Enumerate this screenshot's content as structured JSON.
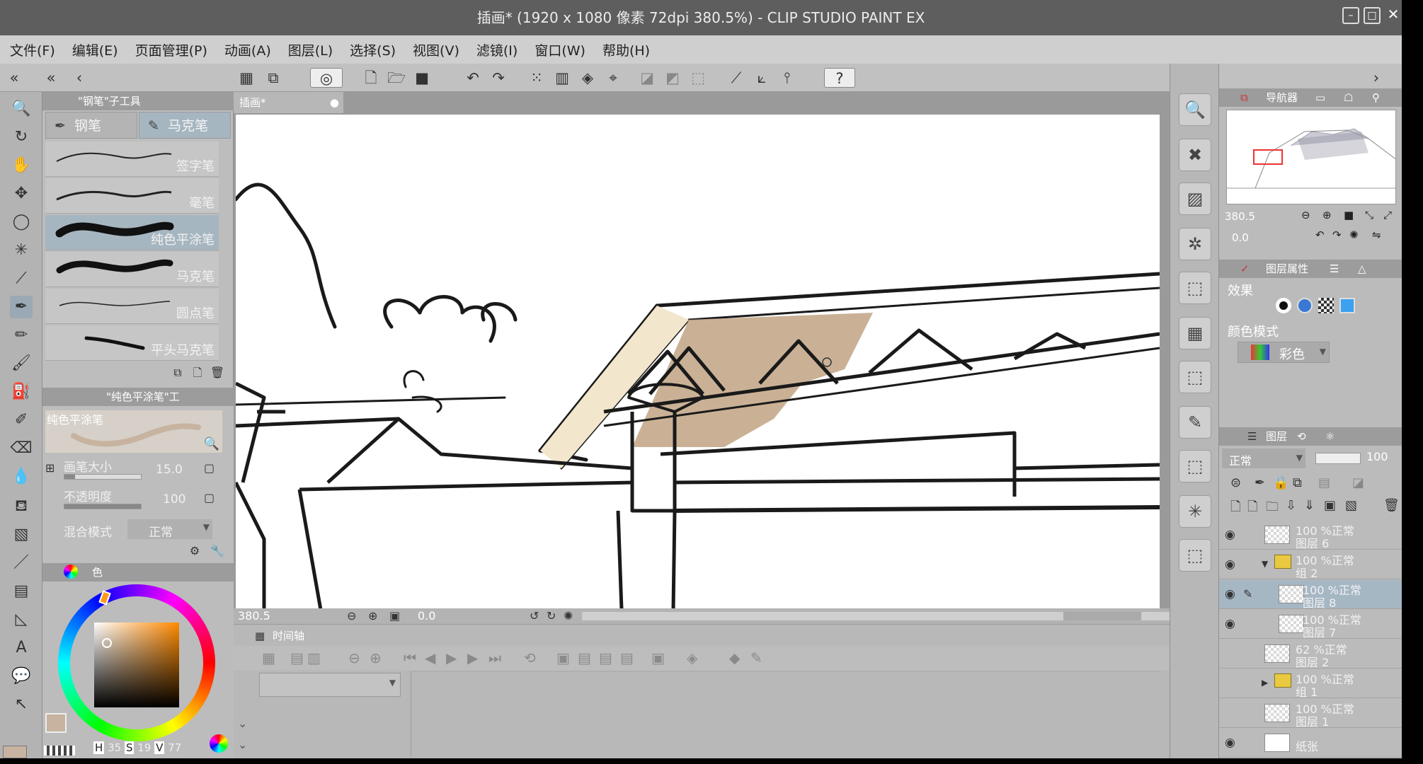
{
  "title": "插画* (1920 x 1080 像素 72dpi 380.5%) - CLIP STUDIO PAINT EX",
  "menu": [
    "文件(F)",
    "编辑(E)",
    "页面管理(P)",
    "动画(A)",
    "图层(L)",
    "选择(S)",
    "视图(V)",
    "滤镜(I)",
    "窗口(W)",
    "帮助(H)"
  ],
  "subtool": {
    "header": "\"钢笔\"子工具",
    "tabs": [
      "钢笔",
      "马克笔"
    ],
    "brushes": [
      "签字笔",
      "毫笔",
      "纯色平涂笔",
      "马克笔",
      "圆点笔",
      "平头马克笔"
    ]
  },
  "tool_property": {
    "header": "\"纯色平涂笔\"工",
    "preview_label": "纯色平涂笔",
    "brush_size_label": "画笔大小",
    "brush_size_value": "15.0",
    "opacity_label": "不透明度",
    "opacity_value": "100",
    "blend_label": "混合模式",
    "blend_value": "正常"
  },
  "color": {
    "tab_label": "色",
    "main_color": "#c7b39f",
    "hsv": {
      "h_label": "H",
      "h": "35",
      "s_label": "S",
      "s": "19",
      "v_label": "V",
      "v": "77"
    }
  },
  "canvas": {
    "tab": "插画*",
    "zoom": "380.5",
    "angle": "0.0",
    "fill_color": "#c4a88b"
  },
  "timeline": {
    "tab": "时间轴"
  },
  "navigator": {
    "tab": "导航器",
    "zoom": "380.5",
    "angle": "0.0"
  },
  "layer_property": {
    "tab": "图层属性",
    "effect_label": "效果",
    "color_mode_label": "颜色模式",
    "color_mode_value": "彩色"
  },
  "layers": {
    "tab": "图层",
    "blend": "正常",
    "opacity": "100",
    "items": [
      {
        "pct": "100 %正常",
        "name": "图层 6",
        "kind": "layer",
        "visible": true,
        "selected": false,
        "indent": 0
      },
      {
        "pct": "100 %正常",
        "name": "组 2",
        "kind": "folder-open",
        "visible": true,
        "selected": false,
        "indent": 0
      },
      {
        "pct": "100 %正常",
        "name": "图层 8",
        "kind": "layer",
        "visible": true,
        "selected": true,
        "indent": 1
      },
      {
        "pct": "100 %正常",
        "name": "图层 7",
        "kind": "layer",
        "visible": true,
        "selected": false,
        "indent": 1
      },
      {
        "pct": "62 %正常",
        "name": "图层 2",
        "kind": "layer",
        "visible": false,
        "selected": false,
        "indent": 0
      },
      {
        "pct": "100 %正常",
        "name": "组 1",
        "kind": "folder",
        "visible": false,
        "selected": false,
        "indent": 0
      },
      {
        "pct": "100 %正常",
        "name": "图层 1",
        "kind": "layer",
        "visible": false,
        "selected": false,
        "indent": 0
      },
      {
        "pct": "",
        "name": "纸张",
        "kind": "paper",
        "visible": true,
        "selected": false,
        "indent": 0
      }
    ]
  }
}
